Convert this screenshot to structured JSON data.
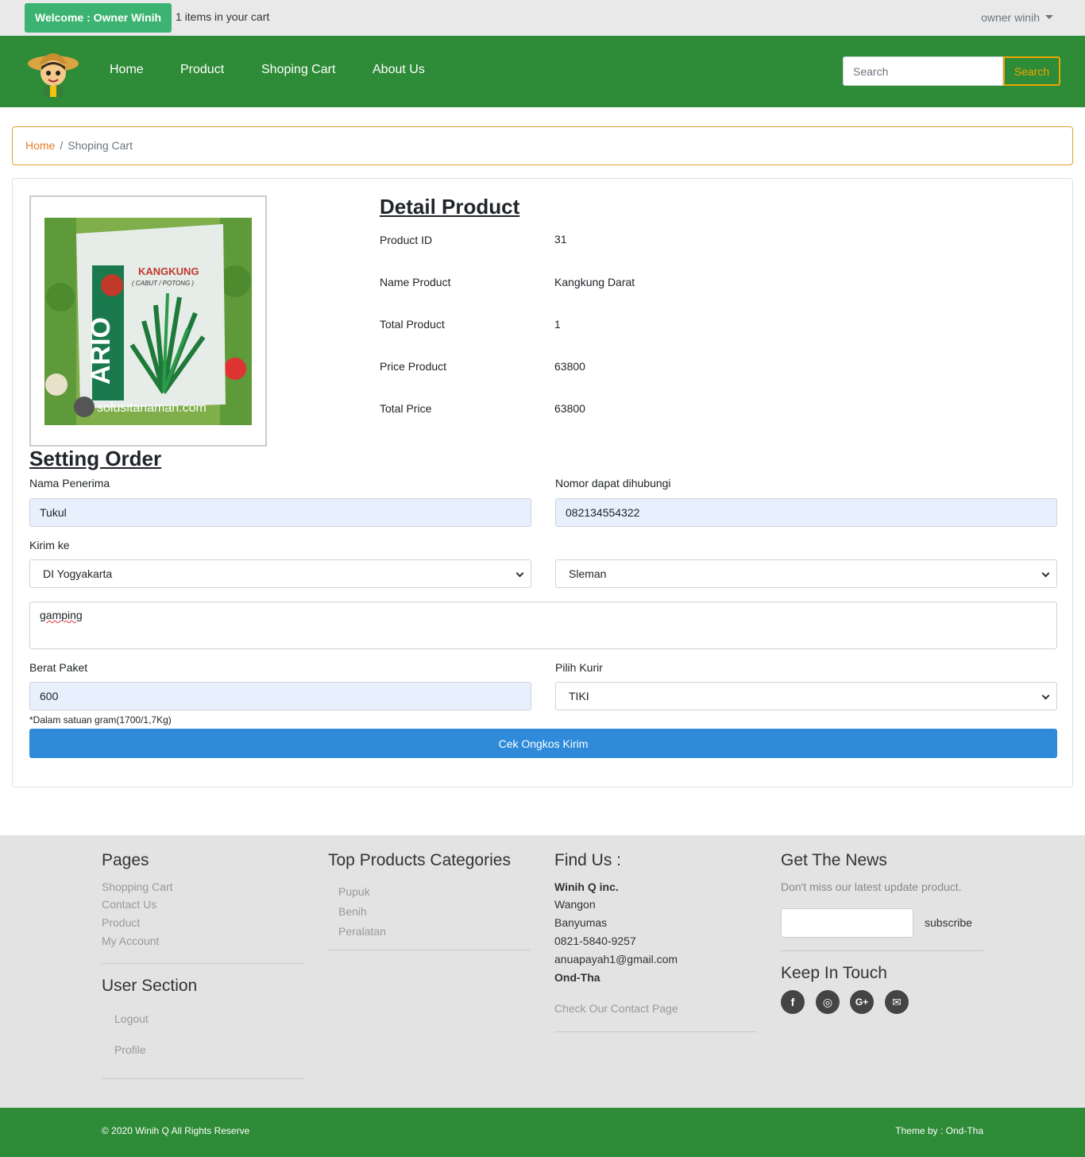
{
  "topbar": {
    "welcome": "Welcome : Owner Winih",
    "cart_info": "1 items in your cart",
    "user": "owner winih"
  },
  "nav": {
    "links": [
      "Home",
      "Product",
      "Shoping Cart",
      "About Us"
    ],
    "search_placeholder": "Search",
    "search_button": "Search"
  },
  "breadcrumb": {
    "home": "Home",
    "separator": "/",
    "current": "Shoping Cart"
  },
  "product_image": {
    "brand_text": "KANGKUNG",
    "sub_text": "( CABUT / POTONG )",
    "side_text": "ARIO",
    "watermark": "solusitanaman.com"
  },
  "detail": {
    "title": "Detail Product",
    "rows": [
      {
        "label": "Product ID",
        "value": "31"
      },
      {
        "label": "Name Product",
        "value": "Kangkung Darat"
      },
      {
        "label": "Total Product",
        "value": "1"
      },
      {
        "label": "Price Product",
        "value": "63800"
      },
      {
        "label": "Total Price",
        "value": "63800"
      }
    ]
  },
  "order": {
    "title": "Setting Order",
    "nama_label": "Nama Penerima",
    "nama_value": "Tukul",
    "nomor_label": "Nomor dapat dihubungi",
    "nomor_value": "082134554322",
    "kirim_label": "Kirim ke",
    "province": "DI Yogyakarta",
    "city": "Sleman",
    "address": "gamping",
    "berat_label": "Berat Paket",
    "berat_value": "600",
    "kurir_label": "Pilih Kurir",
    "kurir_value": "TIKI",
    "note": "*Dalam satuan gram(1700/1,7Kg)",
    "submit": "Cek Ongkos Kirim"
  },
  "footer": {
    "pages_title": "Pages",
    "pages": [
      "Shopping Cart",
      "Contact Us",
      "Product",
      "My Account"
    ],
    "user_title": "User Section",
    "user_links": [
      "Logout",
      "Profile"
    ],
    "categories_title": "Top Products Categories",
    "categories": [
      "Pupuk",
      "Benih",
      "Peralatan"
    ],
    "find_title": "Find Us :",
    "company": "Winih Q inc.",
    "address_lines": [
      "Wangon",
      "Banyumas",
      "0821-5840-9257",
      "anuapayah1@gmail.com"
    ],
    "owner": "Ond-Tha",
    "contact_link": "Check Our Contact Page",
    "news_title": "Get The News",
    "news_text": "Don't miss our latest update product.",
    "subscribe": "subscribe",
    "keep_title": "Keep In Touch",
    "social_icons": [
      "facebook-icon",
      "instagram-icon",
      "google-plus-icon",
      "envelope-icon"
    ],
    "social_glyphs": [
      "f",
      "◎",
      "G+",
      "✉"
    ],
    "copyright": "© 2020 Winih Q All Rights Reserve",
    "theme": "Theme by : Ond-Tha"
  }
}
